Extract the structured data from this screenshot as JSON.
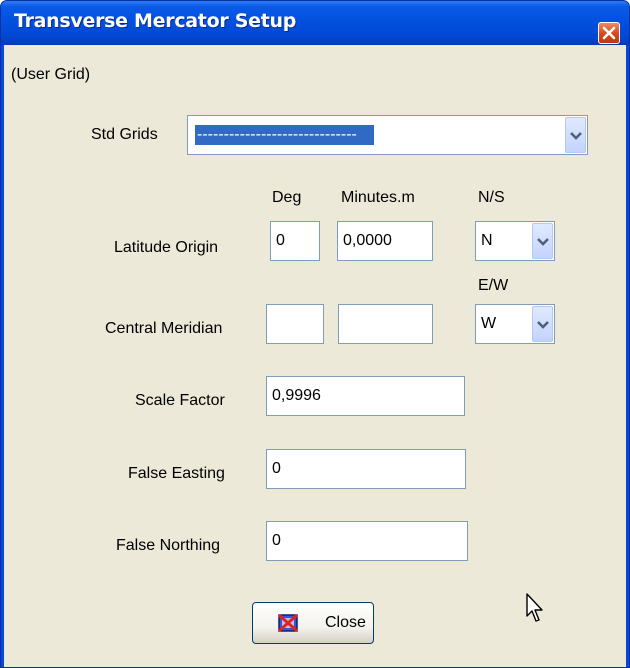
{
  "window": {
    "title": "Transverse Mercator Setup"
  },
  "grid_name": "(User Grid)",
  "std_grids": {
    "label": "Std Grids",
    "value": "------------------------------"
  },
  "headers": {
    "deg": "Deg",
    "minutes": "Minutes.m",
    "ns": "N/S",
    "ew": "E/W"
  },
  "latitude_origin": {
    "label": "Latitude Origin",
    "deg": "0",
    "minutes": "0,0000",
    "hemisphere": "N"
  },
  "central_meridian": {
    "label": "Central Meridian",
    "deg": "",
    "minutes": "",
    "hemisphere": "W"
  },
  "scale_factor": {
    "label": "Scale Factor",
    "value": "0,9996"
  },
  "false_easting": {
    "label": "False Easting",
    "value": "0"
  },
  "false_northing": {
    "label": "False Northing",
    "value": "0"
  },
  "close_button": {
    "label": "Close"
  },
  "colors": {
    "titlebar": "#0350df",
    "client": "#ece9d8",
    "selection": "#316ac5",
    "field_border": "#7f9db9"
  },
  "icons": [
    "close-x-icon",
    "chevron-down-icon",
    "cancel-icon",
    "mouse-pointer-icon"
  ]
}
